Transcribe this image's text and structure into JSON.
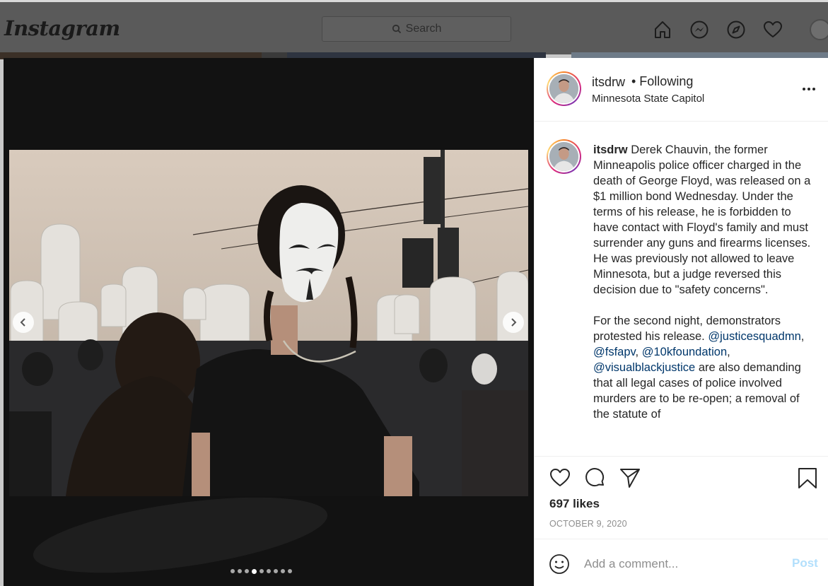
{
  "nav": {
    "logo": "Instagram",
    "search_placeholder": "Search",
    "icons": [
      "home-icon",
      "messenger-icon",
      "explore-compass-icon",
      "activity-heart-icon",
      "profile-avatar"
    ]
  },
  "post": {
    "username": "itsdrw",
    "follow_status": "• Following",
    "location": "Minnesota State Capitol",
    "carousel": {
      "total_slides": 9,
      "active_index": 4
    },
    "caption": {
      "username": "itsdrw",
      "paragraph1": "Derek Chauvin, the former Minneapolis police officer charged in the death of George Floyd, was released on a $1 million bond Wednesday. Under the terms of his release, he is forbidden to have contact with Floyd's family and must surrender any guns and firearms licenses. He was previously not allowed to leave Minnesota, but a judge reversed this decision due to \"safety concerns\".",
      "paragraph2_start": "For the second night, demonstrators protested his release.",
      "mention1": "@justicesquadmn",
      "mention2": "@fsfapv",
      "mention3": "@10kfoundation",
      "mention4": "@visualblackjustice",
      "paragraph2_end": "are also demanding that all legal cases of police involved murders are to be re-open; a removal of the statute of"
    },
    "likes": "697 likes",
    "date": "OCTOBER 9, 2020",
    "comment_placeholder": "Add a comment...",
    "post_label": "Post"
  },
  "colors": {
    "link": "#00376b",
    "post_button_disabled": "#b2dffc",
    "muted_text": "#8e8e8e",
    "overlay": "#5a5a5a"
  }
}
